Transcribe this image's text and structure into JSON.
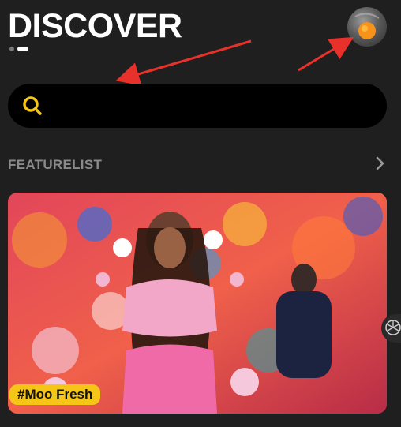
{
  "header": {
    "title": "DISCOVER"
  },
  "pager": {
    "count": 2,
    "active": 1
  },
  "search": {
    "placeholder": "",
    "value": ""
  },
  "section": {
    "title": "FEATURELIST"
  },
  "feature": {
    "tag": "#Moo Fresh"
  },
  "icons": {
    "search": "search-icon",
    "chevron": "chevron-right-icon",
    "avatar": "avatar",
    "handle": "side-handle-icon"
  },
  "colors": {
    "background": "#1f1f1f",
    "accent": "#f5c518",
    "annotation_arrow": "#e8312a",
    "section_title": "#8a8a8a"
  }
}
